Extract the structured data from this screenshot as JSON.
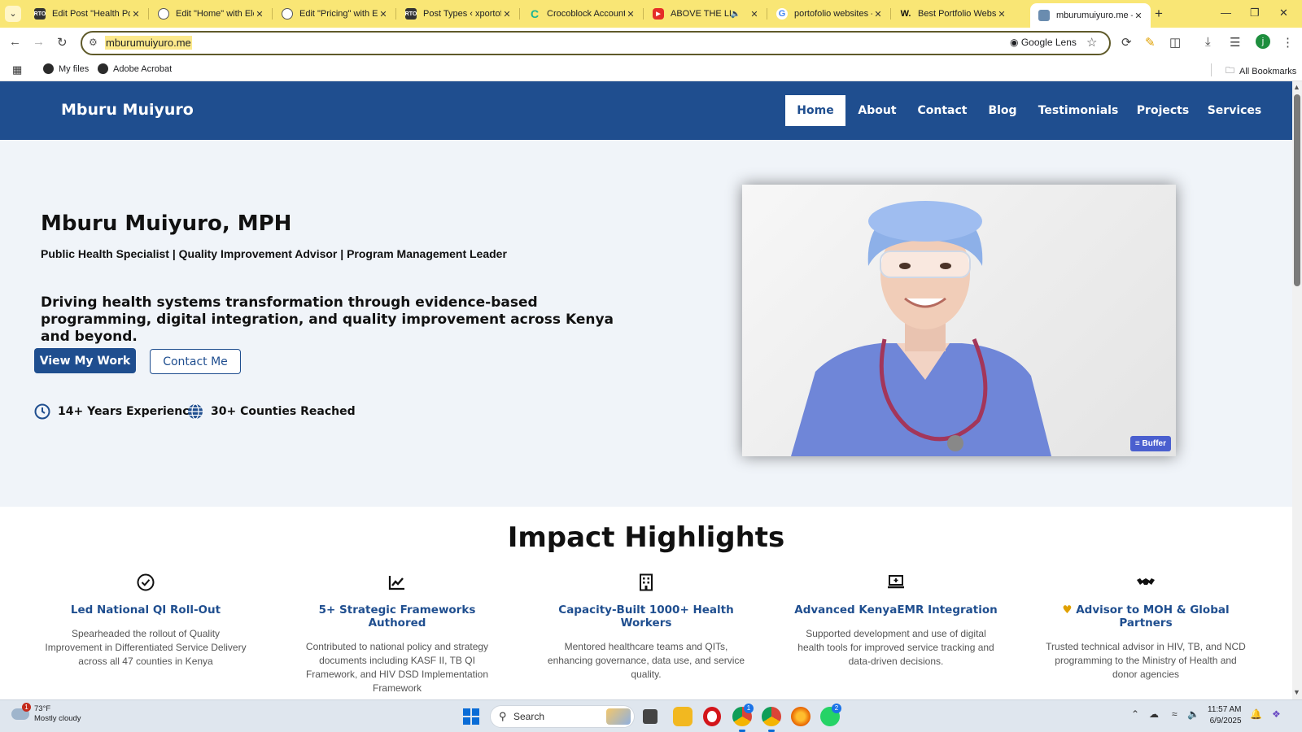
{
  "browser": {
    "tabs": [
      {
        "title": "Edit Post \"Health Port",
        "favicon": "rto-favicon",
        "color": "#333333"
      },
      {
        "title": "Edit \"Home\" with Ele",
        "favicon": "wordpress-favicon",
        "color": "#555555"
      },
      {
        "title": "Edit \"Pricing\" with Ele",
        "favicon": "wordpress-favicon",
        "color": "#555555"
      },
      {
        "title": "Post Types ‹ xportofo",
        "favicon": "rto-favicon",
        "color": "#333333"
      },
      {
        "title": "Crocoblock Account",
        "favicon": "crocoblock-favicon",
        "color": "#1ab394"
      },
      {
        "title": "ABOVE THE LINE",
        "favicon": "youtube-favicon",
        "color": "#e52d27"
      },
      {
        "title": "portofolio websites -",
        "favicon": "google-favicon",
        "color": "#4285f4"
      },
      {
        "title": "Best Portfolio Websit",
        "favicon": "wix-favicon",
        "color": "#111111"
      },
      {
        "title": "mburumuiyuro.me –",
        "favicon": "site-favicon",
        "color": "#6a8caf",
        "active": true
      }
    ],
    "url": "mburumuiyuro.me",
    "lens_label": "Google Lens",
    "bookmarks": [
      {
        "label": "My files"
      },
      {
        "label": "Adobe Acrobat"
      }
    ],
    "all_bookmarks_label": "All Bookmarks",
    "profile_initial": "j"
  },
  "site": {
    "logo": "Mburu Muiyuro",
    "nav": [
      {
        "label": "Home",
        "active": true
      },
      {
        "label": "About"
      },
      {
        "label": "Contact"
      },
      {
        "label": "Blog"
      },
      {
        "label": "Testimonials"
      },
      {
        "label": "Projects"
      },
      {
        "label": "Services"
      }
    ],
    "hero": {
      "title": "Mburu Muiyuro, MPH",
      "subtitle": "Public Health Specialist | Quality Improvement Advisor | Program Management Leader",
      "lead": "Driving health systems transformation through evidence-based programming, digital integration, and quality improvement across Kenya and beyond.",
      "primary_button": "View My Work",
      "secondary_button": "Contact Me",
      "stats": [
        {
          "icon": "clock-icon",
          "label": "14+ Years Experience"
        },
        {
          "icon": "globe-icon",
          "label": "30+ Counties Reached"
        }
      ],
      "photo_badge": "Buffer"
    },
    "impact": {
      "title": "Impact Highlights",
      "cards": [
        {
          "icon": "check-circle-icon",
          "title": "Led National QI Roll-Out",
          "text": "Spearheaded the rollout of Quality Improvement in Differentiated Service Delivery across all 47 counties in Kenya"
        },
        {
          "icon": "chart-line-icon",
          "title": "5+ Strategic Frameworks Authored",
          "text": "Contributed to national policy and strategy documents including KASF II, TB QI Framework, and HIV DSD Implementation Framework"
        },
        {
          "icon": "building-icon",
          "title": "Capacity-Built 1000+ Health Workers",
          "text": "Mentored healthcare teams and QITs, enhancing governance, data use, and service quality."
        },
        {
          "icon": "laptop-icon",
          "title": "Advanced KenyaEMR Integration",
          "text": "Supported development and use of digital health tools for improved service tracking and data-driven decisions."
        },
        {
          "icon": "handshake-icon",
          "title": "Advisor to MOH & Global Partners",
          "text": "Trusted technical advisor in HIV, TB, and NCD programming to the Ministry of Health and donor agencies"
        }
      ]
    },
    "brand_color": "#1f4e8f"
  },
  "taskbar": {
    "weather_temp": "73°F",
    "weather_desc": "Mostly cloudy",
    "weather_badge": "1",
    "search_label": "Search",
    "time": "11:57 AM",
    "date": "6/9/2025",
    "chrome_badge": "1",
    "whatsapp_badge": "2"
  }
}
